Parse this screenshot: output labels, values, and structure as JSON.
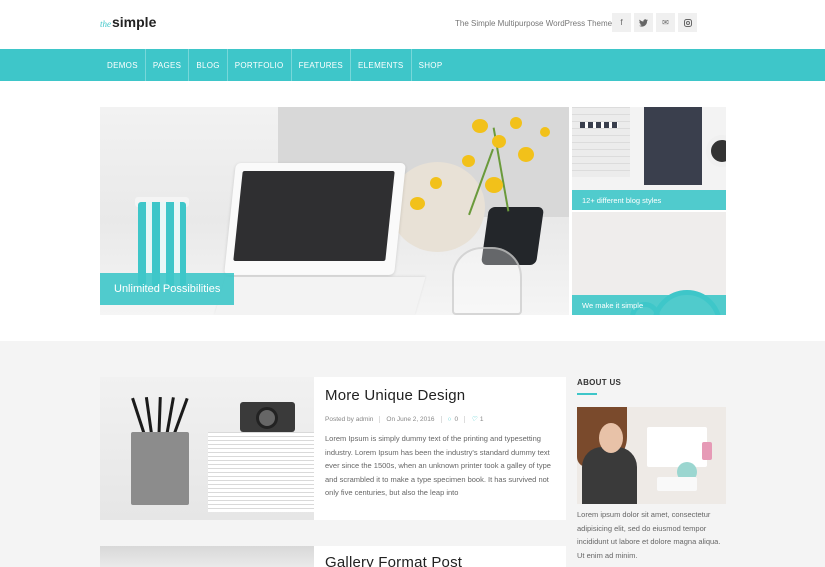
{
  "header": {
    "logo_prefix": "the",
    "logo_main": "simple",
    "tagline": "The Simple Multipurpose WordPress Theme",
    "socials": [
      {
        "icon": "facebook-icon",
        "glyph": "f"
      },
      {
        "icon": "twitter-icon",
        "glyph": "🐦"
      },
      {
        "icon": "email-icon",
        "glyph": "✉"
      },
      {
        "icon": "instagram-icon",
        "glyph": "◎"
      }
    ]
  },
  "nav": {
    "items": [
      "DEMOS",
      "PAGES",
      "BLOG",
      "PORTFOLIO",
      "FEATURES",
      "ELEMENTS",
      "SHOP"
    ]
  },
  "hero": {
    "main_label": "Unlimited Possibilities",
    "side1_label": "12+ different blog styles",
    "side2_label": "We make it simple"
  },
  "posts": [
    {
      "title": "More Unique Design",
      "author": "Posted by admin",
      "date": "On June 2, 2016",
      "comments": "0",
      "likes": "1",
      "excerpt": "Lorem Ipsum is simply dummy text of the printing and typesetting industry. Lorem Ipsum has been the industry's standard dummy text ever since the 1500s, when an unknown printer took a galley of type and scrambled it to make a type specimen book. It has survived not only five centuries, but also the leap into"
    },
    {
      "title": "Gallery Format Post"
    }
  ],
  "sidebar": {
    "about_heading": "ABOUT US",
    "about_text": "Lorem ipsum dolor sit amet, consectetur adipisicing elit, sed do eiusmod tempor incididunt ut labore et dolore magna aliqua. Ut enim ad minim."
  },
  "colors": {
    "accent": "#3ec6c9",
    "content_bg": "#f4f4f4"
  }
}
